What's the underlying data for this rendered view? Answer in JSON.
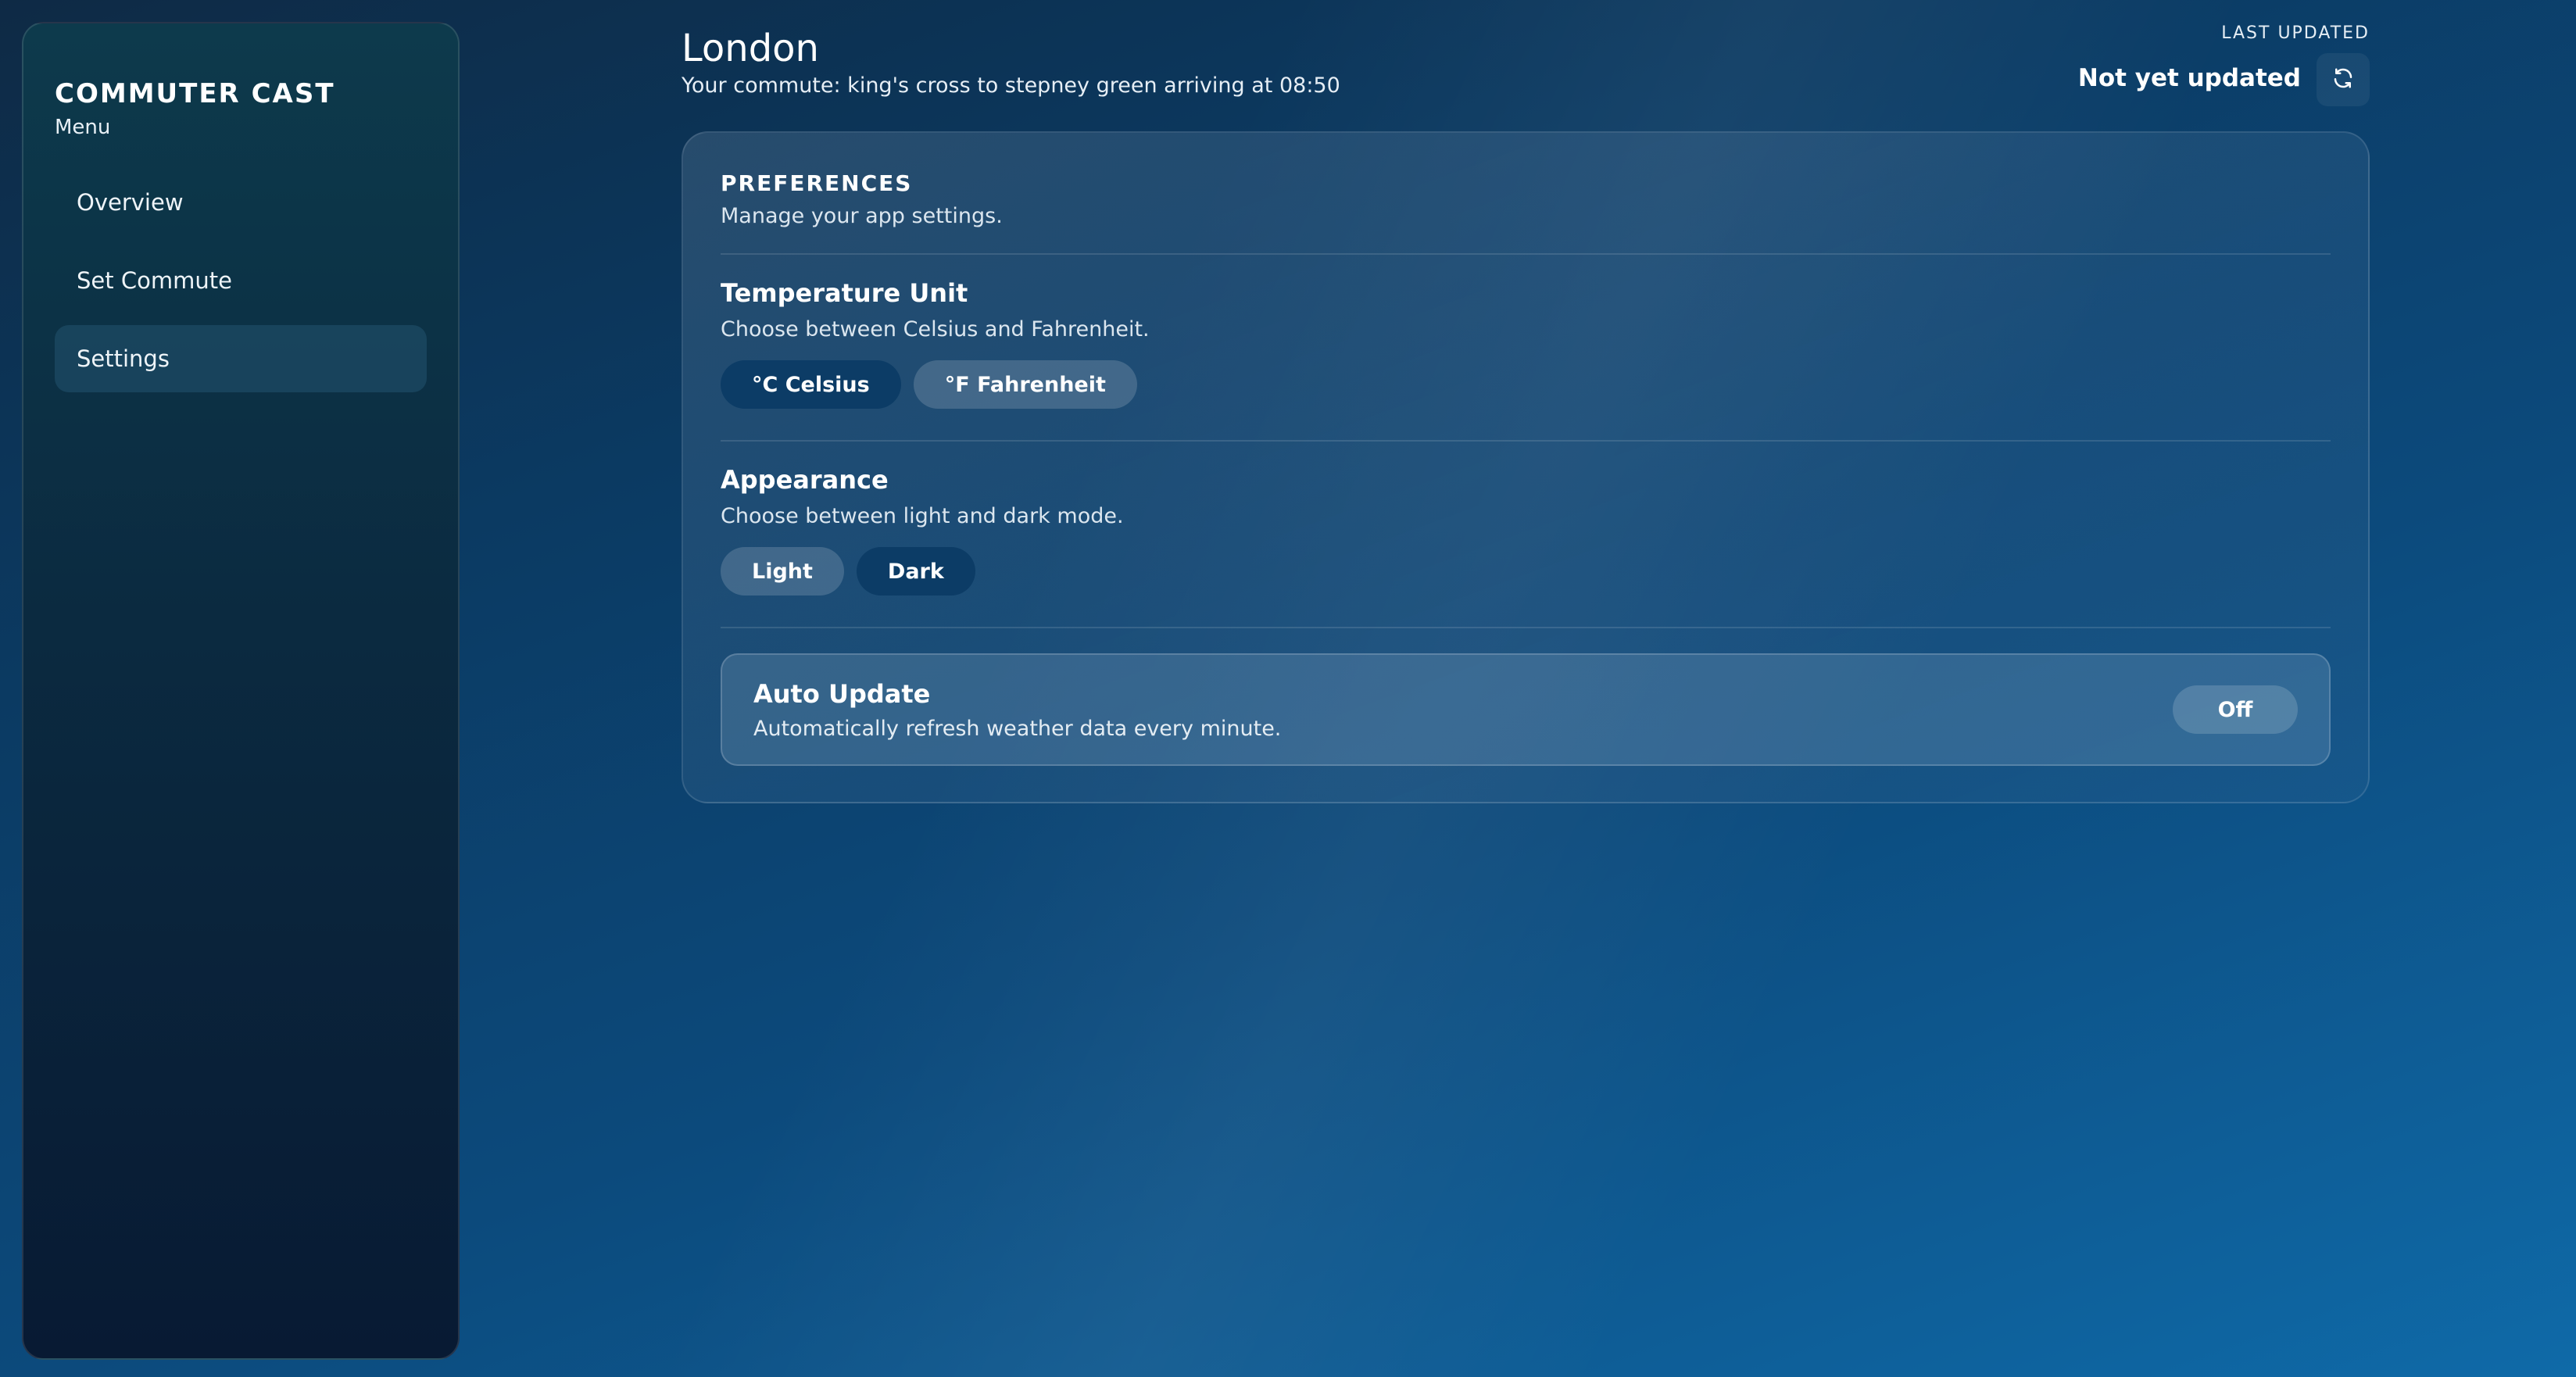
{
  "app": {
    "brand": "COMMUTER CAST",
    "menu_label": "Menu"
  },
  "sidebar": {
    "items": [
      {
        "label": "Overview",
        "active": false
      },
      {
        "label": "Set Commute",
        "active": false
      },
      {
        "label": "Settings",
        "active": true
      }
    ]
  },
  "header": {
    "city": "London",
    "commute": "Your commute: king's cross to stepney green arriving at 08:50",
    "last_updated_label": "LAST UPDATED",
    "last_updated_value": "Not yet updated",
    "refresh_icon": "refresh-icon"
  },
  "preferences": {
    "title": "PREFERENCES",
    "subtitle": "Manage your app settings.",
    "temperature": {
      "title": "Temperature Unit",
      "description": "Choose between Celsius and Fahrenheit.",
      "options": [
        "°C Celsius",
        "°F Fahrenheit"
      ],
      "selected": "°C Celsius"
    },
    "appearance": {
      "title": "Appearance",
      "description": "Choose between light and dark mode.",
      "options": [
        "Light",
        "Dark"
      ],
      "selected": "Dark"
    },
    "auto_update": {
      "title": "Auto Update",
      "description": "Automatically refresh weather data every minute.",
      "toggle_label": "Off"
    }
  },
  "colors": {
    "selected_pill": "#0c3c66",
    "sidebar_active": "#1d4a62"
  }
}
